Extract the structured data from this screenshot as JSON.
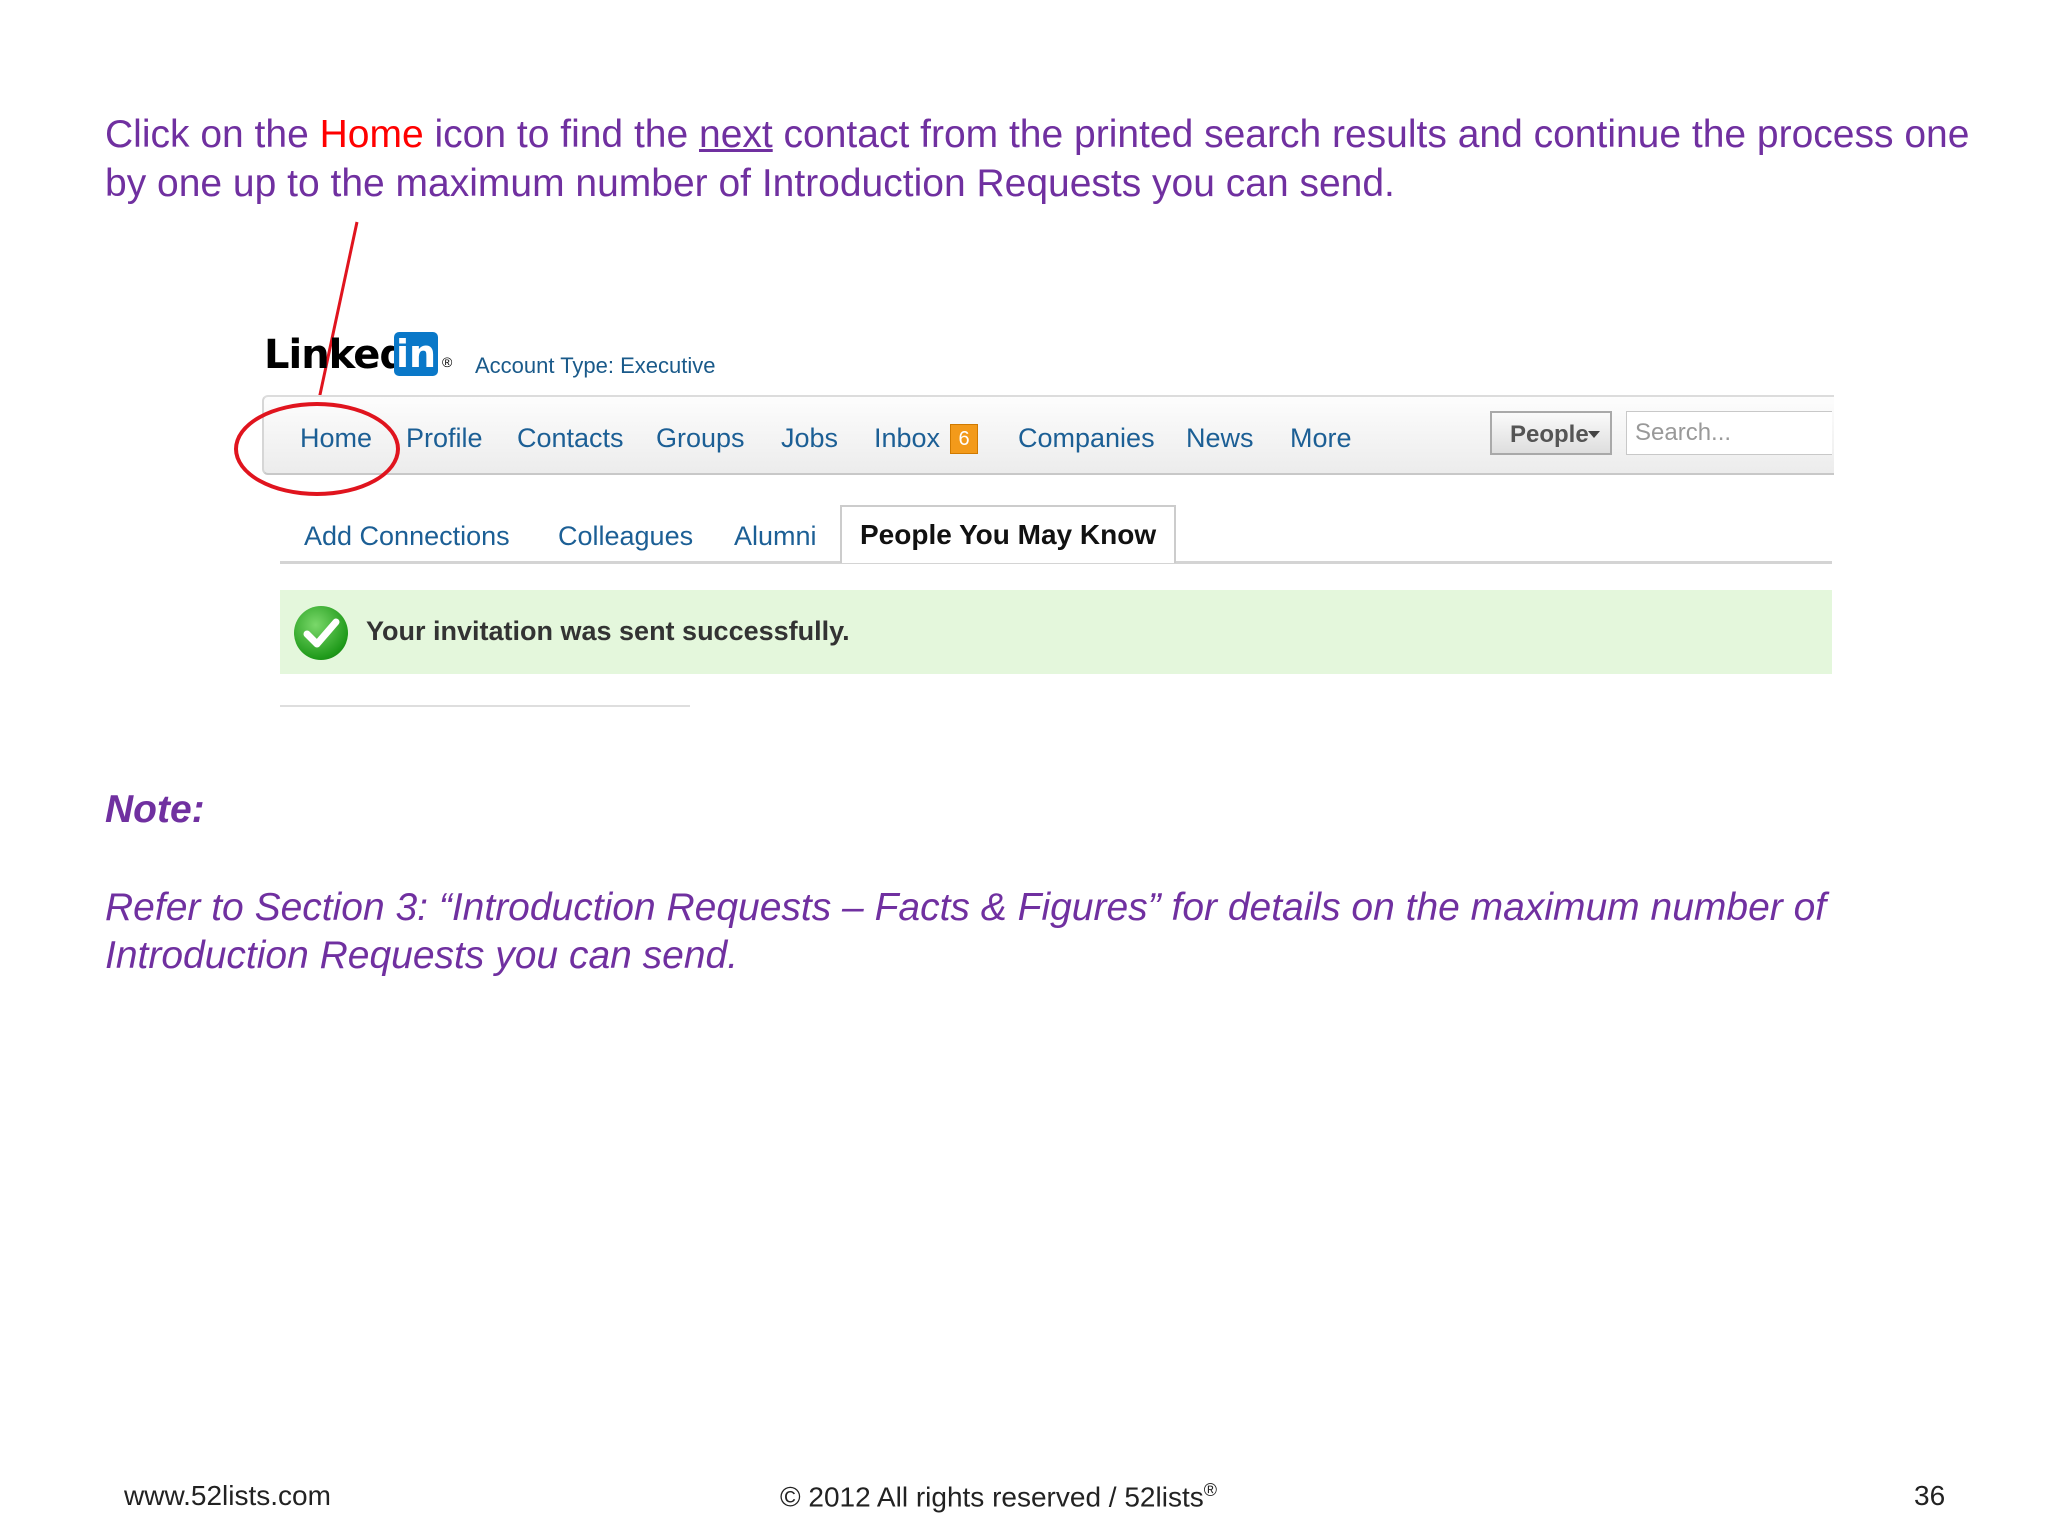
{
  "instruction": {
    "part1": "Click on the ",
    "home_word": "Home",
    "part2": " icon to find the ",
    "next_word": "next",
    "part3": " contact from the printed search results and continue the process one by one up to the maximum number of Introduction Requests you can send."
  },
  "linkedin": {
    "logo_text": "Linked",
    "logo_in": "in",
    "logo_reg": "®",
    "account_type": "Account Type: Executive",
    "nav": [
      "Home",
      "Profile",
      "Contacts",
      "Groups",
      "Jobs",
      "Inbox",
      "Companies",
      "News",
      "More"
    ],
    "inbox_badge": "6",
    "search": {
      "scope": "People",
      "placeholder": "Search..."
    },
    "subtabs": [
      "Add Connections",
      "Colleagues",
      "Alumni",
      "People You May Know"
    ],
    "success_message": "Your invitation was sent successfully."
  },
  "note": {
    "heading": "Note:",
    "body": "Refer to Section 3: “Introduction Requests – Facts & Figures” for details on the maximum number of Introduction Requests you can send."
  },
  "footer": {
    "website": "www.52lists.com",
    "copyright": "© 2012 All rights reserved / 52lists",
    "copyright_mark": "®",
    "page_number": "36"
  },
  "colors": {
    "text_purple": "#7030a0",
    "highlight_red": "#ff0000",
    "linkedin_blue": "#0a78c8",
    "annotation_red": "#e0141e"
  }
}
